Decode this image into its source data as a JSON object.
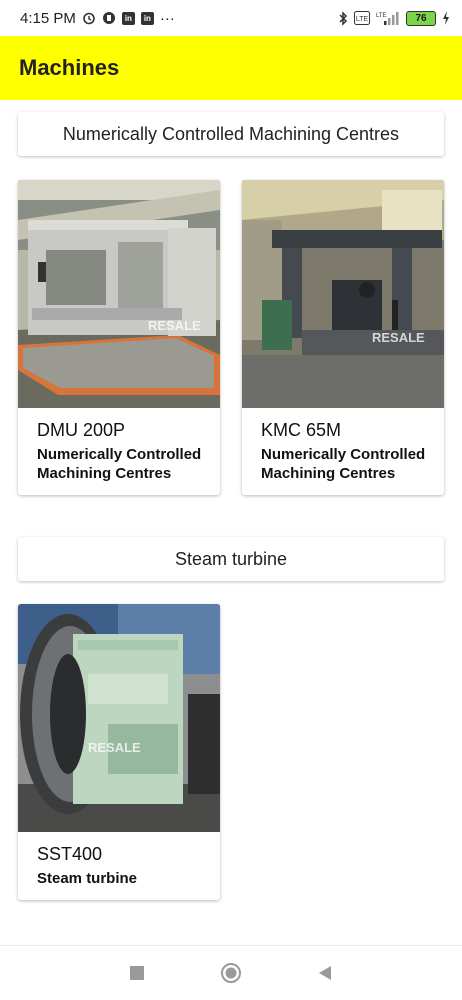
{
  "status_bar": {
    "time": "4:15 PM",
    "battery": "76",
    "network": "LTE"
  },
  "app_bar": {
    "title": "Machines"
  },
  "categories": [
    {
      "title": "Numerically Controlled Machining Centres",
      "items": [
        {
          "name": "DMU 200P",
          "category": "Numerically Controlled Machining Centres",
          "watermark": "RESALE"
        },
        {
          "name": "KMC 65M",
          "category": "Numerically Controlled Machining Centres",
          "watermark": "RESALE"
        }
      ]
    },
    {
      "title": "Steam turbine",
      "items": [
        {
          "name": "SST400",
          "category": "Steam turbine",
          "watermark": "RESALE"
        }
      ]
    }
  ],
  "colors": {
    "app_bar": "#ffff00",
    "battery": "#7cd44a"
  },
  "nav_icons": [
    "recent-apps-icon",
    "home-icon",
    "back-icon"
  ]
}
